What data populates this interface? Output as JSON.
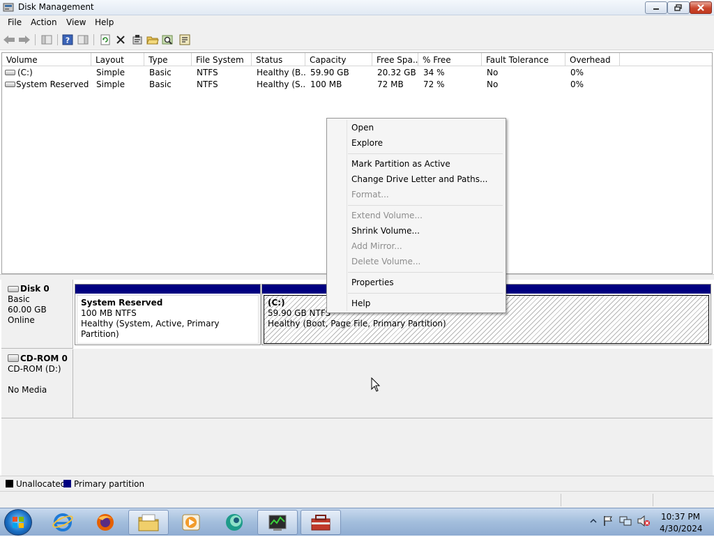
{
  "window": {
    "title": "Disk Management"
  },
  "menubar": {
    "items": [
      "File",
      "Action",
      "View",
      "Help"
    ]
  },
  "volume_table": {
    "headers": [
      "Volume",
      "Layout",
      "Type",
      "File System",
      "Status",
      "Capacity",
      "Free Spa...",
      "% Free",
      "Fault Tolerance",
      "Overhead"
    ],
    "rows": [
      [
        "(C:)",
        "Simple",
        "Basic",
        "NTFS",
        "Healthy (B...",
        "59.90 GB",
        "20.32 GB",
        "34 %",
        "No",
        "0%"
      ],
      [
        "System Reserved",
        "Simple",
        "Basic",
        "NTFS",
        "Healthy (S...",
        "100 MB",
        "72 MB",
        "72 %",
        "No",
        "0%"
      ]
    ]
  },
  "disks": {
    "disk0": {
      "name": "Disk 0",
      "type": "Basic",
      "size": "60.00 GB",
      "state": "Online",
      "partitions": [
        {
          "name": "System Reserved",
          "size": "100 MB NTFS",
          "status": "Healthy (System, Active, Primary Partition)"
        },
        {
          "name": "(C:)",
          "size": "59.90 GB NTFS",
          "status": "Healthy (Boot, Page File, Primary Partition)"
        }
      ]
    },
    "cdrom0": {
      "name": "CD-ROM 0",
      "drive": "CD-ROM (D:)",
      "media": "No Media"
    }
  },
  "legend": {
    "unallocated": "Unallocated",
    "unallocated_color": "#000000",
    "primary": "Primary partition",
    "primary_color": "#000080"
  },
  "context_menu": {
    "items": [
      {
        "label": "Open",
        "enabled": true
      },
      {
        "label": "Explore",
        "enabled": true
      },
      {
        "label": "Mark Partition as Active",
        "enabled": true
      },
      {
        "label": "Change Drive Letter and Paths...",
        "enabled": true
      },
      {
        "label": "Format...",
        "enabled": false
      },
      {
        "label": "Extend Volume...",
        "enabled": false
      },
      {
        "label": "Shrink Volume...",
        "enabled": true
      },
      {
        "label": "Add Mirror...",
        "enabled": false
      },
      {
        "label": "Delete Volume...",
        "enabled": false
      },
      {
        "label": "Properties",
        "enabled": true
      },
      {
        "label": "Help",
        "enabled": true
      }
    ]
  },
  "toolbar": {
    "icons": [
      "back-icon",
      "forward-icon",
      "console-tree-icon",
      "help-icon",
      "action-pane-icon",
      "refresh-icon",
      "delete-icon",
      "properties-icon",
      "open-icon",
      "search-icon",
      "export-icon"
    ]
  },
  "taskbar": {
    "apps": [
      "internet-explorer-icon",
      "firefox-icon",
      "file-explorer-icon",
      "media-player-icon",
      "app-icon",
      "task-manager-icon",
      "computer-management-icon"
    ],
    "tray_icons": [
      "show-hidden-icons",
      "action-center-icon",
      "network-icon",
      "volume-muted-icon"
    ],
    "time": "10:37 PM",
    "date": "4/30/2024"
  }
}
